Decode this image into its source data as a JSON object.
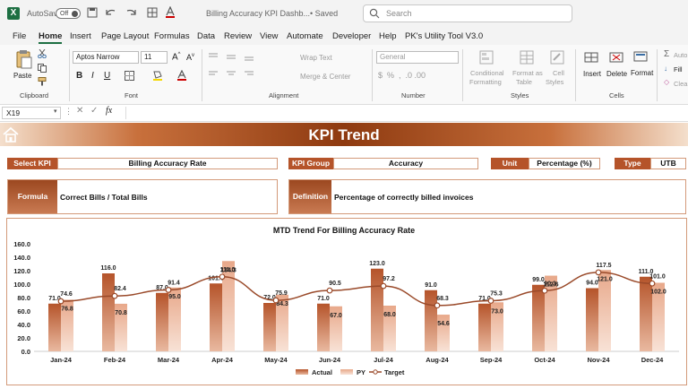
{
  "titlebar": {
    "logo": "X",
    "autosave_label": "AutoSave",
    "autosave_state": "Off",
    "filename": "Billing Accuracy KPI Dashb...",
    "saved_status": "• Saved",
    "search_placeholder": "Search"
  },
  "menu": [
    "File",
    "Home",
    "Insert",
    "Page Layout",
    "Formulas",
    "Data",
    "Review",
    "View",
    "Automate",
    "Developer",
    "Help",
    "PK's Utility Tool V3.0"
  ],
  "ribbon": {
    "paste": "Paste",
    "clipboard": "Clipboard",
    "font_name": "Aptos Narrow",
    "font_size": "11",
    "font_group": "Font",
    "wrap_text": "Wrap Text",
    "merge_center": "Merge & Center",
    "alignment": "Alignment",
    "number_format": "General",
    "number_group": "Number",
    "conditional_formatting_1": "Conditional",
    "conditional_formatting_2": "Formatting",
    "format_as_table_1": "Format as",
    "format_as_table_2": "Table",
    "cell_styles_1": "Cell",
    "cell_styles_2": "Styles",
    "styles_group": "Styles",
    "insert": "Insert",
    "delete": "Delete",
    "format": "Format",
    "cells_group": "Cells",
    "autosum": "Auto",
    "fill": "Fill",
    "clear": "Clea"
  },
  "formula_bar": {
    "name_box": "X19",
    "fx": "fx",
    "content": ""
  },
  "dashboard": {
    "title": "KPI Trend",
    "select_kpi_label": "Select KPI",
    "select_kpi_value": "Billing Accuracy Rate",
    "kpi_group_label": "KPI Group",
    "kpi_group_value": "Accuracy",
    "unit_label": "Unit",
    "unit_value": "Percentage (%)",
    "type_label": "Type",
    "type_value": "UTB",
    "formula_label": "Formula",
    "formula_value": "Correct Bills / Total Bills",
    "definition_label": "Definition",
    "definition_value": "Percentage of correctly billed invoices"
  },
  "colors": {
    "accent": "#b5542a",
    "actual": "#b5542a",
    "py": "#e8a88a",
    "target": "#9a4a2a"
  },
  "chart_data": {
    "type": "bar",
    "title": "MTD Trend For Billing Accuracy Rate",
    "categories": [
      "Jan-24",
      "Feb-24",
      "Mar-24",
      "Apr-24",
      "May-24",
      "Jun-24",
      "Jul-24",
      "Aug-24",
      "Sep-24",
      "Oct-24",
      "Nov-24",
      "Dec-24"
    ],
    "series": [
      {
        "name": "Actual",
        "type": "bar",
        "values": [
          71.0,
          116.0,
          87.0,
          101.0,
          72.0,
          71.0,
          123.0,
          91.0,
          71.0,
          99.0,
          94.0,
          111.0
        ]
      },
      {
        "name": "PY",
        "type": "bar",
        "values": [
          76.8,
          70.8,
          95.0,
          134.3,
          84.3,
          67.0,
          68.0,
          54.6,
          73.0,
          112.6,
          121.0,
          102.0
        ]
      },
      {
        "name": "Target",
        "type": "line",
        "values": [
          74.6,
          82.4,
          91.4,
          111.0,
          75.9,
          90.5,
          97.2,
          68.3,
          75.3,
          90.3,
          117.5,
          101.0
        ]
      }
    ],
    "ylim": [
      0,
      160
    ],
    "yticks": [
      "0.0",
      "20.0",
      "40.0",
      "60.0",
      "80.0",
      "100.0",
      "120.0",
      "140.0",
      "160.0"
    ],
    "legend": "bottom",
    "grid": false
  }
}
